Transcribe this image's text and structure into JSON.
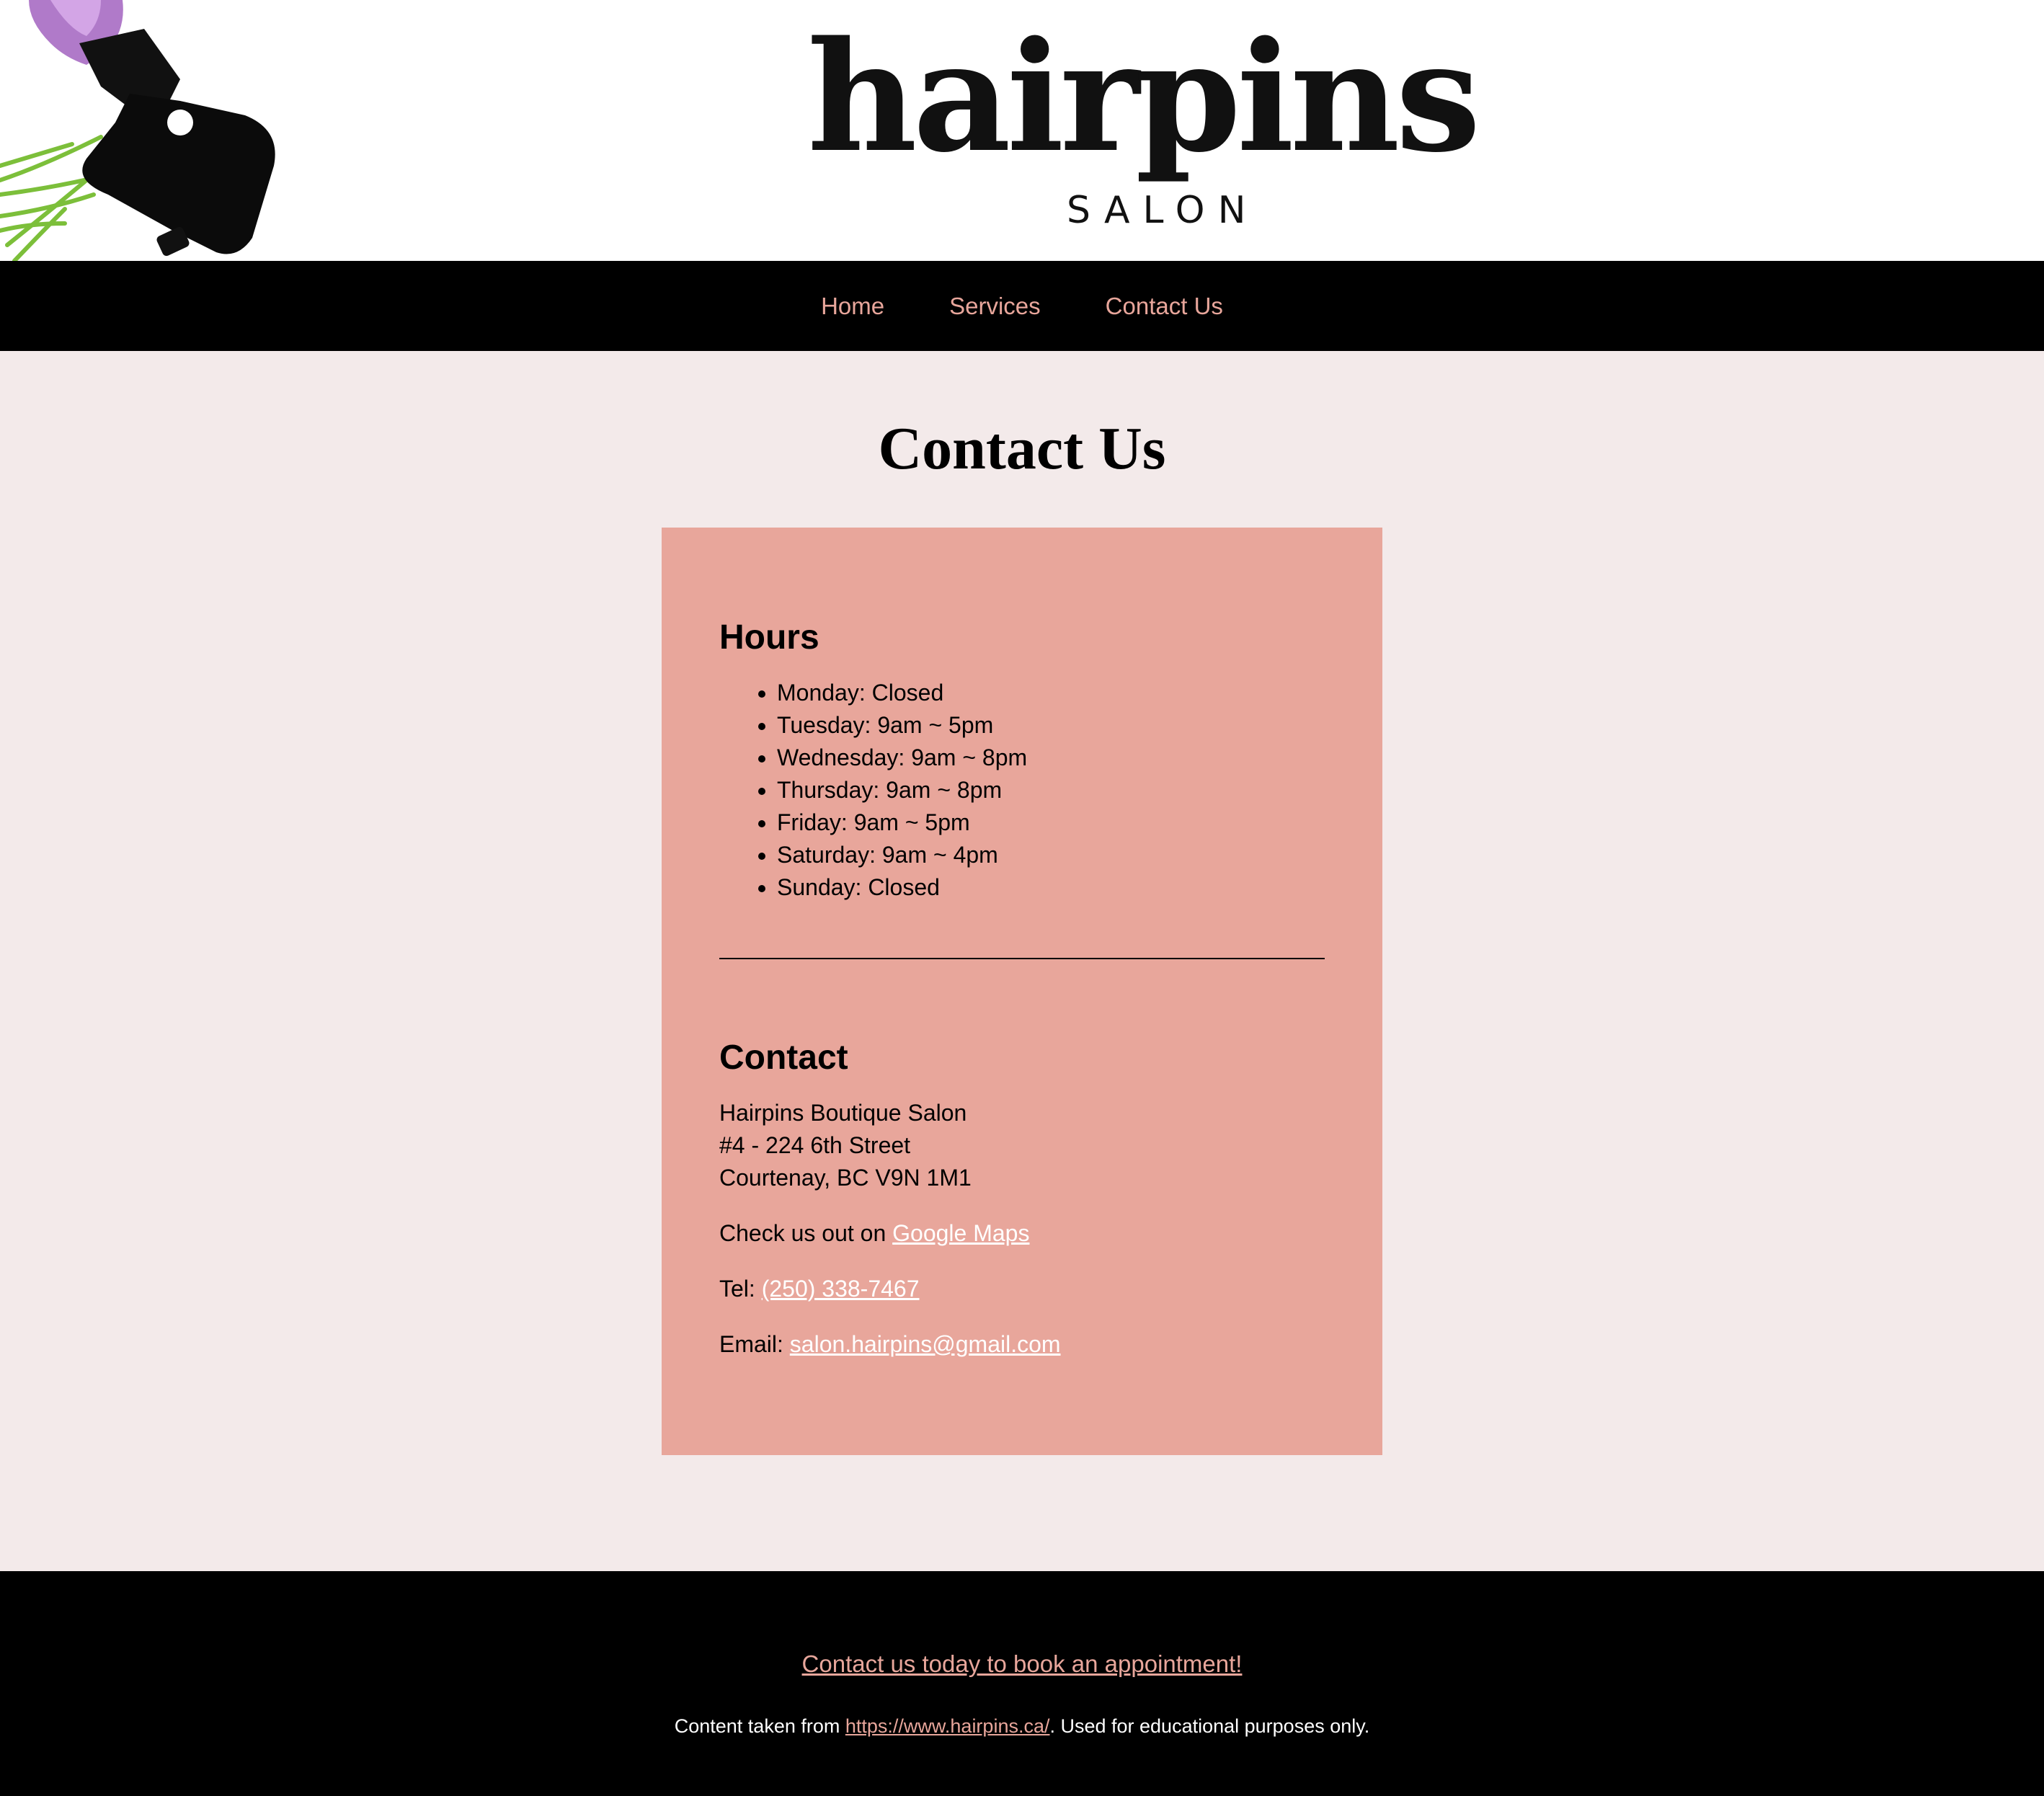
{
  "header": {
    "logo_wordmark": "hairpins",
    "logo_subtitle": "SALON",
    "decoration_icon": "spray-bottle-icon"
  },
  "nav": {
    "items": [
      {
        "label": "Home"
      },
      {
        "label": "Services"
      },
      {
        "label": "Contact Us"
      }
    ]
  },
  "main": {
    "title": "Contact Us",
    "hours": {
      "heading": "Hours",
      "items": [
        "Monday: Closed",
        "Tuesday: 9am ~ 5pm",
        "Wednesday: 9am ~ 8pm",
        "Thursday: 9am ~ 8pm",
        "Friday: 9am ~ 5pm",
        "Saturday: 9am ~ 4pm",
        "Sunday: Closed"
      ]
    },
    "contact": {
      "heading": "Contact",
      "address_lines": [
        "Hairpins Boutique Salon",
        "#4 - 224 6th Street",
        "Courtenay, BC V9N 1M1"
      ],
      "maps_prefix": "Check us out on ",
      "maps_link": "Google Maps",
      "tel_prefix": "Tel: ",
      "tel_link": "(250) 338-7467",
      "email_prefix": "Email: ",
      "email_link": "salon.hairpins@gmail.com"
    }
  },
  "footer": {
    "cta_link": "Contact us today to book an appointment!",
    "note_prefix": "Content taken from ",
    "note_link": "https://www.hairpins.ca/",
    "note_suffix": ". Used for educational purposes only."
  },
  "colors": {
    "accent": "#e8a69b",
    "page_background": "#f3eaea",
    "nav_background": "#000000"
  }
}
